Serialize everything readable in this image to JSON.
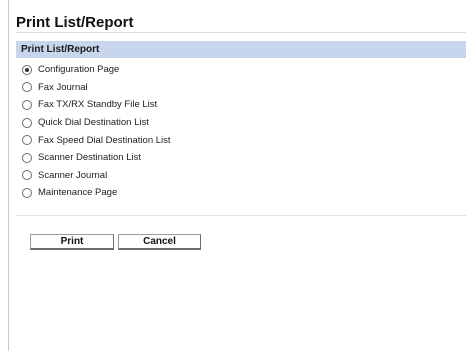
{
  "page": {
    "title": "Print List/Report"
  },
  "section": {
    "header": "Print List/Report"
  },
  "options": [
    {
      "label": "Configuration Page",
      "selected": true
    },
    {
      "label": "Fax Journal",
      "selected": false
    },
    {
      "label": "Fax TX/RX Standby File List",
      "selected": false
    },
    {
      "label": "Quick Dial Destination List",
      "selected": false
    },
    {
      "label": "Fax Speed Dial Destination List",
      "selected": false
    },
    {
      "label": "Scanner Destination List",
      "selected": false
    },
    {
      "label": "Scanner Journal",
      "selected": false
    },
    {
      "label": "Maintenance Page",
      "selected": false
    }
  ],
  "buttons": {
    "print_label": "Print",
    "cancel_label": "Cancel"
  },
  "colors": {
    "section_header_bg": "#c7d6ed",
    "background": "#ffffff"
  }
}
